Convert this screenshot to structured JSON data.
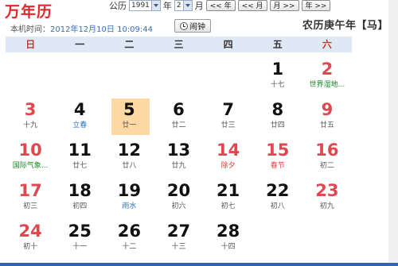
{
  "header": {
    "title": "万年历",
    "calendar_type": "公历",
    "year_value": "1991",
    "year_label": "年",
    "month_value": "2",
    "month_label": "月",
    "buttons": [
      "<< 年",
      "<< 月",
      "月 >>",
      "年 >>"
    ],
    "local_time_label": "本机时间：",
    "local_time_value": "2012年12月10日 10:09:44",
    "alarm_label": "闹钟",
    "lunar_year": "农历庚午年【马】"
  },
  "weekdays": [
    "日",
    "一",
    "二",
    "三",
    "四",
    "五",
    "六"
  ],
  "days": [
    {
      "day": "",
      "sub": ""
    },
    {
      "day": "",
      "sub": ""
    },
    {
      "day": "",
      "sub": ""
    },
    {
      "day": "",
      "sub": ""
    },
    {
      "day": "",
      "sub": ""
    },
    {
      "day": "1",
      "sub": "十七"
    },
    {
      "day": "2",
      "sub": "世界湿地..."
    },
    {
      "day": "3",
      "sub": "十九"
    },
    {
      "day": "4",
      "sub": "立春"
    },
    {
      "day": "5",
      "sub": "廿一"
    },
    {
      "day": "6",
      "sub": "廿二"
    },
    {
      "day": "7",
      "sub": "廿三"
    },
    {
      "day": "8",
      "sub": "廿四"
    },
    {
      "day": "9",
      "sub": "廿五"
    },
    {
      "day": "10",
      "sub": "国际气象..."
    },
    {
      "day": "11",
      "sub": "廿七"
    },
    {
      "day": "12",
      "sub": "廿八"
    },
    {
      "day": "13",
      "sub": "廿九"
    },
    {
      "day": "14",
      "sub": "除夕"
    },
    {
      "day": "15",
      "sub": "春节"
    },
    {
      "day": "16",
      "sub": "初二"
    },
    {
      "day": "17",
      "sub": "初三"
    },
    {
      "day": "18",
      "sub": "初四"
    },
    {
      "day": "19",
      "sub": "雨水"
    },
    {
      "day": "20",
      "sub": "初六"
    },
    {
      "day": "21",
      "sub": "初七"
    },
    {
      "day": "22",
      "sub": "初八"
    },
    {
      "day": "23",
      "sub": "初九"
    },
    {
      "day": "24",
      "sub": "初十"
    },
    {
      "day": "25",
      "sub": "十一"
    },
    {
      "day": "26",
      "sub": "十二"
    },
    {
      "day": "27",
      "sub": "十三"
    },
    {
      "day": "28",
      "sub": "十四"
    }
  ],
  "colors": {
    "weekend": "#e0484f",
    "today_bg": "#fcd9a2",
    "solar_term": "#2a6dc0",
    "festival_red": "#e33b3b",
    "intl_day": "#1a8a25",
    "header_bg": "#dfe8f5"
  }
}
